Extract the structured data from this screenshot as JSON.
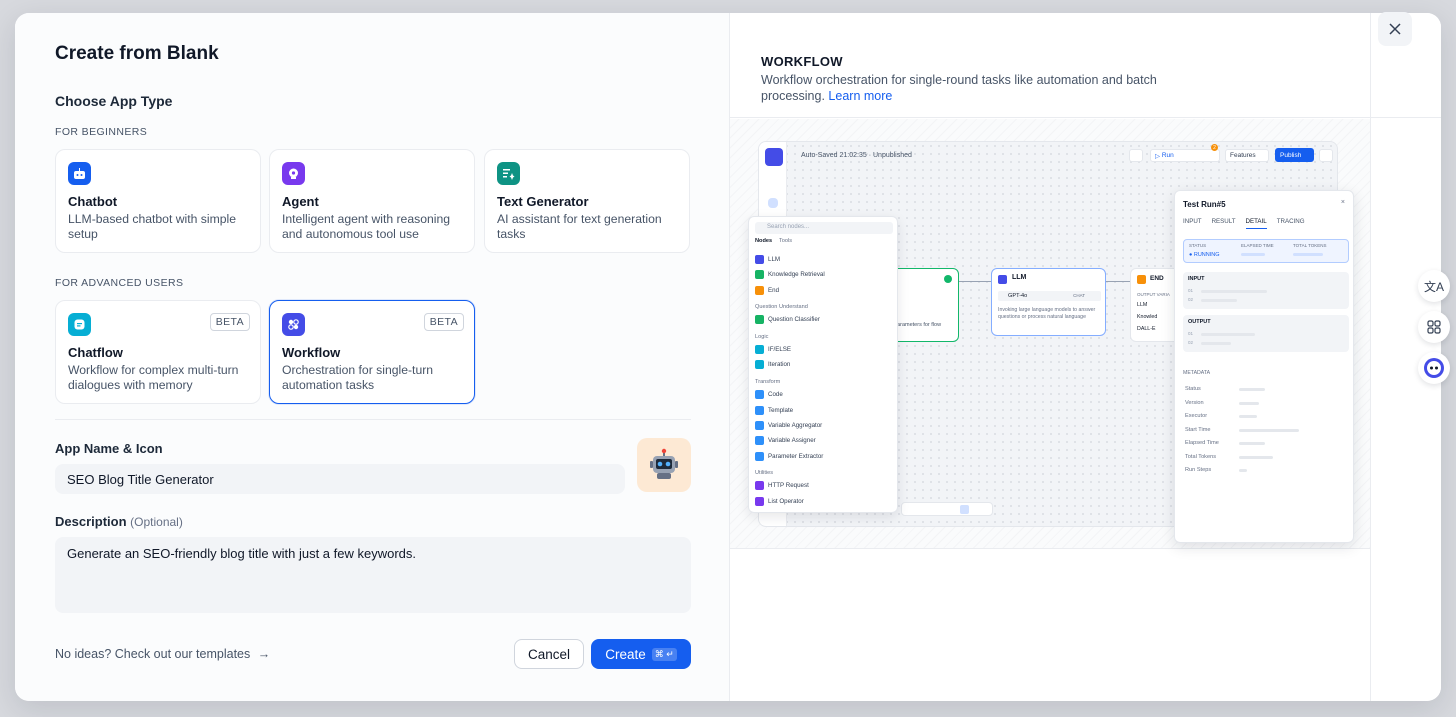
{
  "title": "Create from Blank",
  "choose_label": "Choose App Type",
  "group_beginners": "FOR BEGINNERS",
  "group_advanced": "FOR ADVANCED USERS",
  "cards": [
    {
      "name": "Chatbot",
      "desc": "LLM-based chatbot with simple setup",
      "icon": "chatbot-icon",
      "color": "#155eef"
    },
    {
      "name": "Agent",
      "desc": "Intelligent agent with reasoning and autonomous tool use",
      "icon": "agent-icon",
      "color": "#7839ee"
    },
    {
      "name": "Text Generator",
      "desc": "AI assistant for text generation tasks",
      "icon": "text-generator-icon",
      "color": "#0e9384"
    },
    {
      "name": "Chatflow",
      "desc": "Workflow for complex multi-turn dialogues with memory",
      "icon": "chatflow-icon",
      "color": "#06aed4",
      "badge": "BETA"
    },
    {
      "name": "Workflow",
      "desc": "Orchestration for single-turn automation tasks",
      "icon": "workflow-icon",
      "color": "#444ce7",
      "badge": "BETA",
      "selected": true
    }
  ],
  "app_name_label": "App Name & Icon",
  "app_name_value": "SEO Blog Title Generator",
  "description_label": "Description",
  "description_optional": "(Optional)",
  "description_value": "Generate an SEO-friendly blog title with just a few keywords.",
  "templates_link": "No ideas? Check out our templates",
  "cancel_label": "Cancel",
  "create_label": "Create",
  "create_shortcut": "⌘ ↵",
  "preview": {
    "title": "WORKFLOW",
    "desc": "Workflow orchestration for single-round tasks like automation and batch processing.",
    "learn_more": "Learn more",
    "autosaved": "Auto-Saved 21:02:35 · Unpublished",
    "run": "Run",
    "features": "Features",
    "publish": "Publish",
    "run_badge": "2",
    "nodes_search": "Search nodes...",
    "tabs": [
      "Nodes",
      "Tools"
    ],
    "node_items": [
      {
        "label": "LLM",
        "color": "#444ce7"
      },
      {
        "label": "Knowledge Retrieval",
        "color": "#16b364"
      },
      {
        "label": "End",
        "color": "#f79009"
      }
    ],
    "head_question": "Question Understand",
    "question_items": [
      {
        "label": "Question Classifier",
        "color": "#16b364"
      }
    ],
    "head_logic": "Logic",
    "logic_items": [
      {
        "label": "IF/ELSE",
        "color": "#06aed4"
      },
      {
        "label": "Iteration",
        "color": "#06aed4"
      }
    ],
    "head_transform": "Transform",
    "transform_items": [
      {
        "label": "Code",
        "color": "#2e90fa"
      },
      {
        "label": "Template",
        "color": "#2e90fa"
      },
      {
        "label": "Variable Aggregator",
        "color": "#2e90fa"
      },
      {
        "label": "Variable Assigner",
        "color": "#2e90fa"
      },
      {
        "label": "Parameter Extractor",
        "color": "#2e90fa"
      }
    ],
    "head_utilities": "Utilities",
    "utility_items": [
      {
        "label": "HTTP Request",
        "color": "#7839ee"
      },
      {
        "label": "List Operator",
        "color": "#7839ee"
      }
    ],
    "llm_node": {
      "title": "LLM",
      "model": "GPT-4o",
      "tag": "CHAT",
      "desc": "Invoking large language models to answer questions or process natural language"
    },
    "start_node_desc": "parameters for flow",
    "end_node": {
      "title": "END",
      "output_label": "OUTPUT VARIA",
      "items": [
        "LLM",
        "Knowled",
        "DALL-E"
      ]
    },
    "test_run": {
      "title": "Test Run#5",
      "tabs": [
        "INPUT",
        "RESULT",
        "DETAIL",
        "TRACING"
      ],
      "status_label": "STATUS",
      "status_value": "RUNNING",
      "elapsed_label": "ELAPSED TIME",
      "tokens_label": "TOTAL TOKENS",
      "input": "INPUT",
      "output": "OUTPUT",
      "line_nums": [
        "01",
        "02"
      ],
      "metadata": "METADATA",
      "meta_rows": [
        "Status",
        "Version",
        "Executor",
        "Start Time",
        "Elapsed Time",
        "Total Tokens",
        "Run Steps"
      ]
    }
  }
}
